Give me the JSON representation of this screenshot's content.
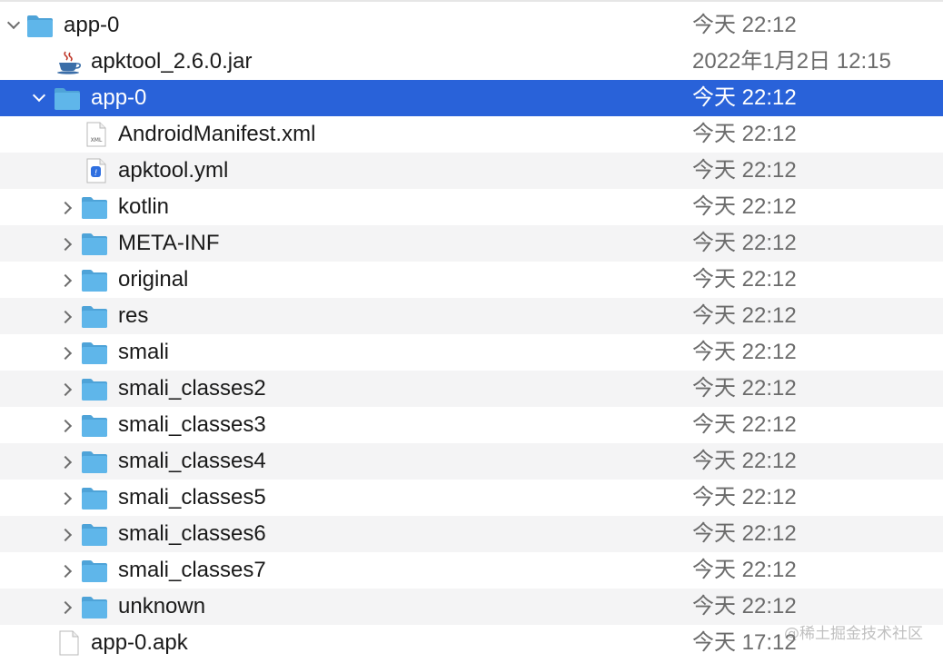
{
  "colors": {
    "selection": "#2962d9",
    "alt_row": "#f4f4f5",
    "folder": "#5fb6ea",
    "date_text": "#6b6b6b"
  },
  "rows": [
    {
      "name": "app-0",
      "date": "今天 22:12",
      "icon": "folder-icon",
      "disclosure": "expanded"
    },
    {
      "name": "apktool_2.6.0.jar",
      "date": "2022年1月2日 12:15",
      "icon": "java-coffee-icon",
      "disclosure": "none"
    },
    {
      "name": "app-0",
      "date": "今天 22:12",
      "icon": "folder-icon",
      "disclosure": "expanded",
      "selected": true
    },
    {
      "name": "AndroidManifest.xml",
      "date": "今天 22:12",
      "icon": "xml-file-icon",
      "icon_text": "XML",
      "disclosure": "none"
    },
    {
      "name": "apktool.yml",
      "date": "今天 22:12",
      "icon": "yml-file-icon",
      "icon_text": "!",
      "disclosure": "none"
    },
    {
      "name": "kotlin",
      "date": "今天 22:12",
      "icon": "folder-icon",
      "disclosure": "collapsed"
    },
    {
      "name": "META-INF",
      "date": "今天 22:12",
      "icon": "folder-icon",
      "disclosure": "collapsed"
    },
    {
      "name": "original",
      "date": "今天 22:12",
      "icon": "folder-icon",
      "disclosure": "collapsed"
    },
    {
      "name": "res",
      "date": "今天 22:12",
      "icon": "folder-icon",
      "disclosure": "collapsed"
    },
    {
      "name": "smali",
      "date": "今天 22:12",
      "icon": "folder-icon",
      "disclosure": "collapsed"
    },
    {
      "name": "smali_classes2",
      "date": "今天 22:12",
      "icon": "folder-icon",
      "disclosure": "collapsed"
    },
    {
      "name": "smali_classes3",
      "date": "今天 22:12",
      "icon": "folder-icon",
      "disclosure": "collapsed"
    },
    {
      "name": "smali_classes4",
      "date": "今天 22:12",
      "icon": "folder-icon",
      "disclosure": "collapsed"
    },
    {
      "name": "smali_classes5",
      "date": "今天 22:12",
      "icon": "folder-icon",
      "disclosure": "collapsed"
    },
    {
      "name": "smali_classes6",
      "date": "今天 22:12",
      "icon": "folder-icon",
      "disclosure": "collapsed"
    },
    {
      "name": "smali_classes7",
      "date": "今天 22:12",
      "icon": "folder-icon",
      "disclosure": "collapsed"
    },
    {
      "name": "unknown",
      "date": "今天 22:12",
      "icon": "folder-icon",
      "disclosure": "collapsed"
    },
    {
      "name": "app-0.apk",
      "date": "今天 17:12",
      "icon": "blank-file-icon",
      "disclosure": "none"
    }
  ],
  "watermark": "@稀土掘金技术社区"
}
